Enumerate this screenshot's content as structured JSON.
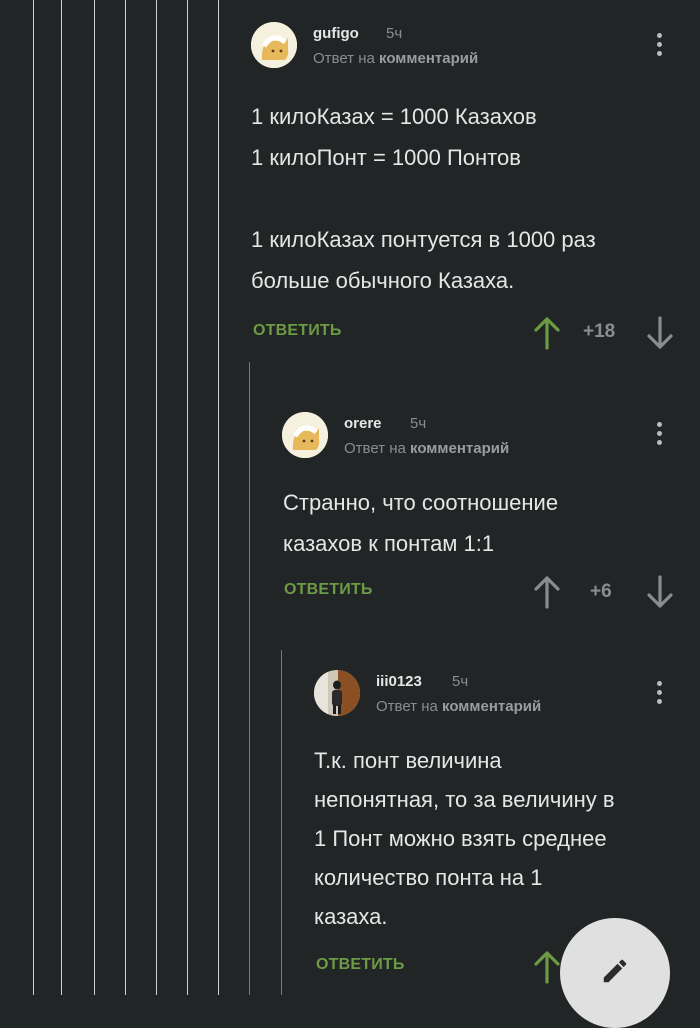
{
  "comments": [
    {
      "username": "gufigo",
      "time": "5ч",
      "reply_prefix": "Ответ на",
      "reply_target": "комментарий",
      "text": "1 килоКазах = 1000 Казахов\n1 килоПонт = 1000 Понтов\n\n1 килоКазах понтуется в 1000 раз\nбольше обычного Казаха.",
      "reply_label": "ОТВЕТИТЬ",
      "score": "+18",
      "avatar": "cat-avatar",
      "vote_color": "#6d9a44"
    },
    {
      "username": "orere",
      "time": "5ч",
      "reply_prefix": "Ответ на",
      "reply_target": "комментарий",
      "text": "Странно, что соотношение\nказахов к понтам 1:1",
      "reply_label": "ОТВЕТИТЬ",
      "score": "+6",
      "avatar": "cat-avatar"
    },
    {
      "username": "iii0123",
      "time": "5ч",
      "reply_prefix": "Ответ на",
      "reply_target": "комментарий",
      "text": "Т.к. понт величина\nнепонятная, то за величину в\n1 Понт можно взять среднее\nколичество понта на 1\nказаха.",
      "reply_label": "ОТВЕТИТЬ",
      "avatar": "photo-avatar"
    }
  ],
  "fab_icon": "pencil-icon",
  "colors": {
    "background": "#222526",
    "accent": "#6d9a44",
    "muted": "#8a8d8f"
  }
}
